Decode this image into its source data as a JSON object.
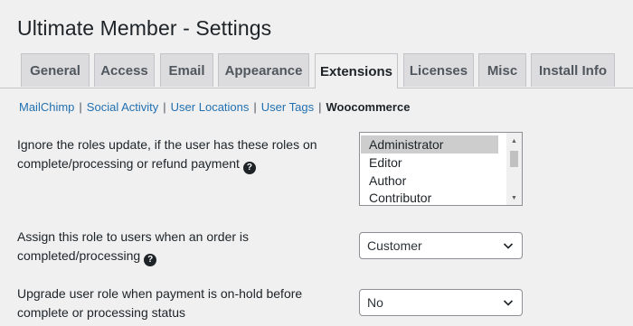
{
  "page": {
    "title": "Ultimate Member - Settings"
  },
  "tabs": [
    {
      "label": "General"
    },
    {
      "label": "Access"
    },
    {
      "label": "Email"
    },
    {
      "label": "Appearance"
    },
    {
      "label": "Extensions",
      "active": true
    },
    {
      "label": "Licenses"
    },
    {
      "label": "Misc"
    },
    {
      "label": "Install Info"
    }
  ],
  "subnav": {
    "links": [
      "MailChimp",
      "Social Activity",
      "User Locations",
      "User Tags"
    ],
    "current": "Woocommerce",
    "separator": "|"
  },
  "settings": {
    "ignore_roles": {
      "label_line1": "Ignore the roles update, if the user has these roles on",
      "label_line2": "complete/processing or refund payment",
      "options": [
        "Administrator",
        "Editor",
        "Author",
        "Contributor"
      ],
      "selected": "Administrator",
      "help_icon": "question-circle-icon"
    },
    "assign_role": {
      "label_line1": "Assign this role to users when an order is",
      "label_line2": "completed/processing",
      "value": "Customer",
      "help_icon": "question-circle-icon"
    },
    "upgrade_role": {
      "label_line1": "Upgrade user role when payment is on-hold before",
      "label_line2": "complete or processing status",
      "value": "No"
    }
  },
  "colors": {
    "background": "#f0f0f1",
    "link": "#2271b1",
    "tab_inactive": "#dcdcde",
    "border": "#8c8f94"
  }
}
